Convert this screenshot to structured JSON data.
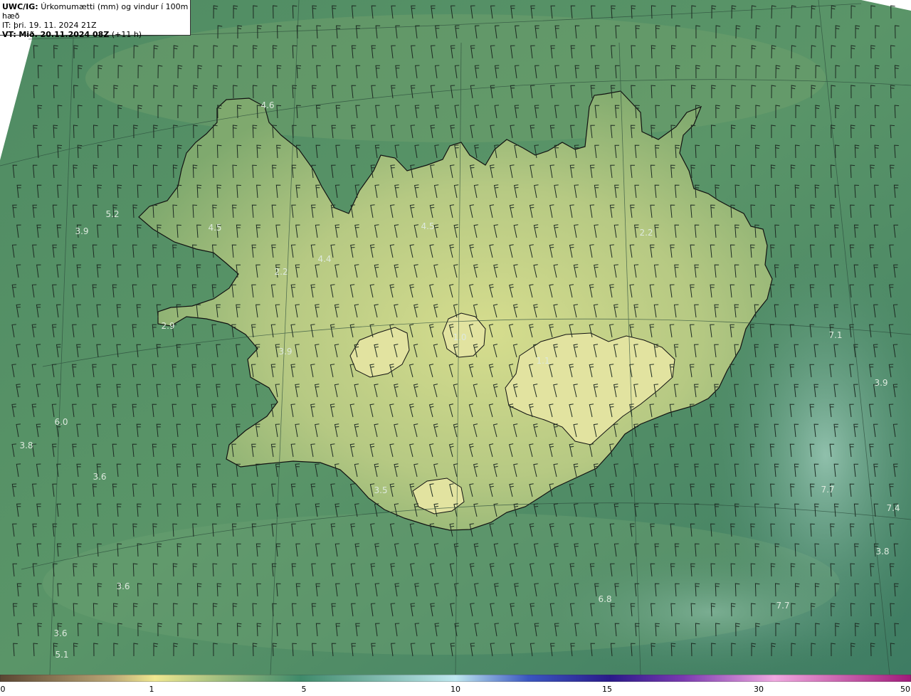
{
  "header": {
    "model": "UWC/IG:",
    "title": "Úrkomumætti (mm) og vindur í 100m hæð",
    "init_time": "IT: þri. 19. 11. 2024 21Z",
    "valid_prefix": "VT:",
    "valid_time": "Mið. 20.11.2024 08Z",
    "lead": "(+11 h)"
  },
  "colors": {
    "ocean_dark": "#3f7a5e",
    "ocean_mid": "#4e8b62",
    "land_low": "#7ba86a",
    "land_high": "#cfd98a",
    "high_precip": "#9fc8b8",
    "coast": "#111111",
    "barb": "#222222"
  },
  "colorbar": {
    "ticks": [
      "0",
      "1",
      "5",
      "10",
      "15",
      "30",
      "50"
    ],
    "stops": [
      "#5a4632",
      "#c9b777",
      "#f0e890",
      "#3f8a6a",
      "#bfe8f0",
      "#3a56c0",
      "#2a1a8a",
      "#a04ac0",
      "#f0a8e0",
      "#a01a7a"
    ]
  },
  "values": [
    {
      "label": "4.6"
    },
    {
      "label": "5.2"
    },
    {
      "label": "3.9"
    },
    {
      "label": "4.5"
    },
    {
      "label": "4.4"
    },
    {
      "label": "2.2"
    },
    {
      "label": "4.5"
    },
    {
      "label": "2.2"
    },
    {
      "label": "2.9"
    },
    {
      "label": "3.9"
    },
    {
      "label": "1.0"
    },
    {
      "label": "1.1"
    },
    {
      "label": "6.0"
    },
    {
      "label": "3.8"
    },
    {
      "label": "3.6"
    },
    {
      "label": "3.5"
    },
    {
      "label": "7.1"
    },
    {
      "label": "3.9"
    },
    {
      "label": "7.7"
    },
    {
      "label": "7.4"
    },
    {
      "label": "3.8"
    },
    {
      "label": "3.6"
    },
    {
      "label": "6.8"
    },
    {
      "label": "7.7"
    },
    {
      "label": "3.6"
    },
    {
      "label": "5.1"
    }
  ]
}
